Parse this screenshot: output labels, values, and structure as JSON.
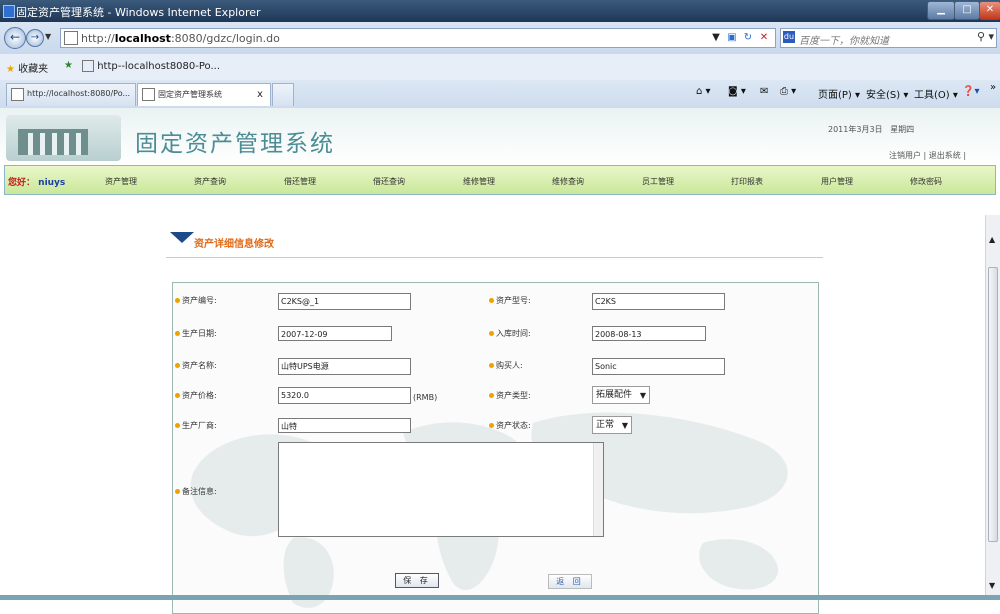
{
  "window": {
    "title": "固定资产管理系统 - Windows Internet Explorer"
  },
  "browser": {
    "url_prefix": "http://",
    "url_host": "localhost",
    "url_rest": ":8080/gdzc/login.do",
    "search_placeholder": "百度一下，你就知道",
    "favorites_label": "收藏夹",
    "favorite_link": "http--localhost8080-Po...",
    "tabs": [
      {
        "label": "http://localhost:8080/Po..."
      },
      {
        "label": "固定资产管理系统"
      }
    ],
    "tab_close": "x",
    "tools": {
      "page": "页面(P)",
      "safety": "安全(S)",
      "tools": "工具(O)"
    }
  },
  "header": {
    "site_title": "固定资产管理系统",
    "date": "2011年3月3日",
    "weekday": "星期四",
    "logout_user": "注销用户",
    "exit_system": "退出系统"
  },
  "nav": {
    "greeting": "您好：",
    "username": "niuys",
    "items": [
      "资产管理",
      "资产查询",
      "借还管理",
      "借还查询",
      "维修管理",
      "维修查询",
      "员工管理",
      "打印报表",
      "用户管理",
      "修改密码"
    ]
  },
  "section_title": "资产详细信息修改",
  "form": {
    "asset_no_label": "资产编号:",
    "asset_no": "C2KS@_1",
    "model_label": "资产型号:",
    "model": "C2KS",
    "prod_date_label": "生产日期:",
    "prod_date": "2007-12-09",
    "stock_date_label": "入库时间:",
    "stock_date": "2008-08-13",
    "name_label": "资产名称:",
    "name": "山特UPS电源",
    "buyer_label": "购买人:",
    "buyer": "Sonic",
    "price_label": "资产价格:",
    "price": "5320.0",
    "price_unit": "(RMB)",
    "type_label": "资产类型:",
    "type_selected": "拓展配件",
    "maker_label": "生产厂商:",
    "maker": "山特",
    "status_label": "资产状态:",
    "status_selected": "正常",
    "remarks_label": "备注信息:",
    "remarks": "",
    "save_label": "保 存",
    "back_label": "返 回"
  }
}
